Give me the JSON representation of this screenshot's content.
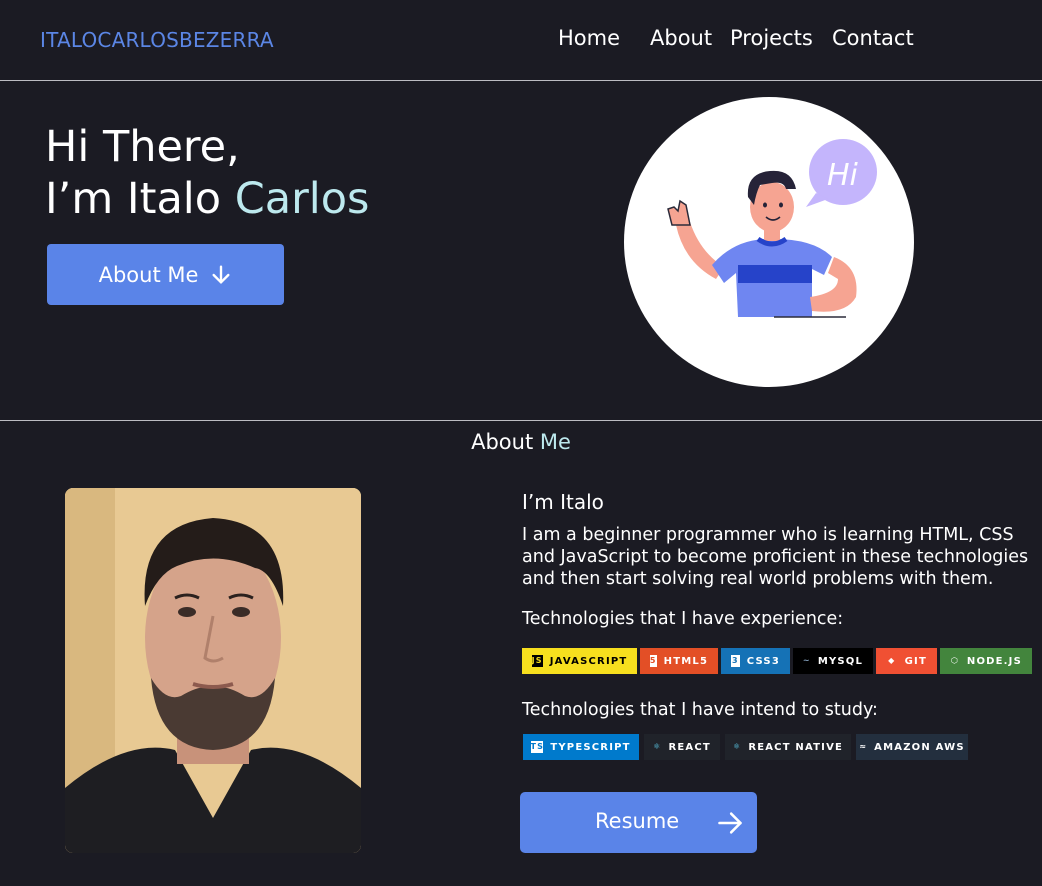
{
  "header": {
    "logo": "ITALOCARLOSBEZERRA",
    "nav": {
      "home": "Home",
      "about": "About",
      "projects": "Projects",
      "contact": "Contact"
    }
  },
  "hero": {
    "greeting": "Hi There,",
    "intro_prefix": "I’m Italo ",
    "intro_highlight": "Carlos",
    "about_button": "About Me",
    "illustration_bubble": "Hi"
  },
  "about": {
    "title_prefix": "About ",
    "title_highlight": "Me",
    "name": "I’m Italo",
    "description": "I am a beginner programmer who is learning HTML, CSS and JavaScript to become proficient in these technologies and then start solving real world problems with them.",
    "experience_heading": "Technologies that I have experience:",
    "experience_badges": [
      {
        "label": "JAVASCRIPT",
        "icon": "JS",
        "bg": "#f7df1e",
        "fg": "#000000",
        "icon_bg": "#000000",
        "icon_fg": "#f7df1e"
      },
      {
        "label": "HTML5",
        "icon": "5",
        "bg": "#e34f26",
        "fg": "#ffffff",
        "icon_bg": "#ffffff",
        "icon_fg": "#e34f26"
      },
      {
        "label": "CSS3",
        "icon": "3",
        "bg": "#1572b6",
        "fg": "#ffffff",
        "icon_bg": "#ffffff",
        "icon_fg": "#1572b6"
      },
      {
        "label": "MYSQL",
        "icon": "~",
        "bg": "#000000",
        "fg": "#ffffff",
        "icon_bg": "#000000",
        "icon_fg": "#8aa8c5"
      },
      {
        "label": "GIT",
        "icon": "◆",
        "bg": "#f05033",
        "fg": "#ffffff",
        "icon_bg": "#f05033",
        "icon_fg": "#ffffff"
      },
      {
        "label": "NODE.JS",
        "icon": "⬡",
        "bg": "#43853d",
        "fg": "#ffffff",
        "icon_bg": "#43853d",
        "icon_fg": "#ffffff"
      }
    ],
    "study_heading": "Technologies that I have intend to study:",
    "study_badges": [
      {
        "label": "TYPESCRIPT",
        "icon": "TS",
        "bg": "#007acc",
        "fg": "#ffffff",
        "icon_bg": "#ffffff",
        "icon_fg": "#007acc"
      },
      {
        "label": "REACT",
        "icon": "⚛",
        "bg": "#20232a",
        "fg": "#ffffff",
        "icon_bg": "#20232a",
        "icon_fg": "#61dafb"
      },
      {
        "label": "REACT NATIVE",
        "icon": "⚛",
        "bg": "#20232a",
        "fg": "#ffffff",
        "icon_bg": "#20232a",
        "icon_fg": "#61dafb"
      },
      {
        "label": "AMAZON AWS",
        "icon": "≈",
        "bg": "#232f3e",
        "fg": "#ffffff",
        "icon_bg": "#232f3e",
        "icon_fg": "#ffffff"
      }
    ],
    "resume_button": "Resume"
  },
  "colors": {
    "background": "#1b1b23",
    "accent_blue": "#5a84e8",
    "highlight": "#bde9ee",
    "logo": "#5b86e5"
  }
}
